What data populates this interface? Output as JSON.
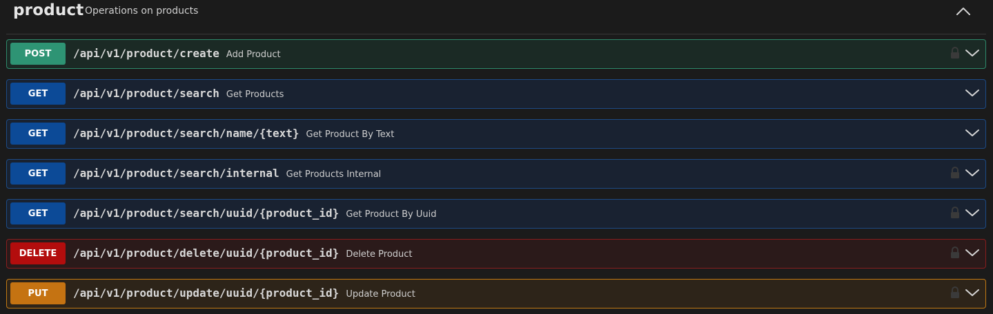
{
  "section": {
    "title": "product",
    "description": "Operations on products"
  },
  "operations": [
    {
      "method": "POST",
      "path": "/api/v1/product/create",
      "summary": "Add Product",
      "locked": true,
      "theme": "post"
    },
    {
      "method": "GET",
      "path": "/api/v1/product/search",
      "summary": "Get Products",
      "locked": false,
      "theme": "get"
    },
    {
      "method": "GET",
      "path": "/api/v1/product/search/name/{text}",
      "summary": "Get Product By Text",
      "locked": false,
      "theme": "get"
    },
    {
      "method": "GET",
      "path": "/api/v1/product/search/internal",
      "summary": "Get Products Internal",
      "locked": true,
      "theme": "get"
    },
    {
      "method": "GET",
      "path": "/api/v1/product/search/uuid/{product_id}",
      "summary": "Get Product By Uuid",
      "locked": true,
      "theme": "get"
    },
    {
      "method": "DELETE",
      "path": "/api/v1/product/delete/uuid/{product_id}",
      "summary": "Delete Product",
      "locked": true,
      "theme": "delete"
    },
    {
      "method": "PUT",
      "path": "/api/v1/product/update/uuid/{product_id}",
      "summary": "Update Product",
      "locked": true,
      "theme": "put"
    }
  ],
  "colors": {
    "post": "#2e9474",
    "get": "#0c4a97",
    "delete": "#b30d0d",
    "put": "#c57312",
    "background": "#1b1b1b"
  },
  "icons": {
    "collapse": "chevron-up-icon",
    "expand": "chevron-down-icon",
    "lock": "lock-icon"
  }
}
